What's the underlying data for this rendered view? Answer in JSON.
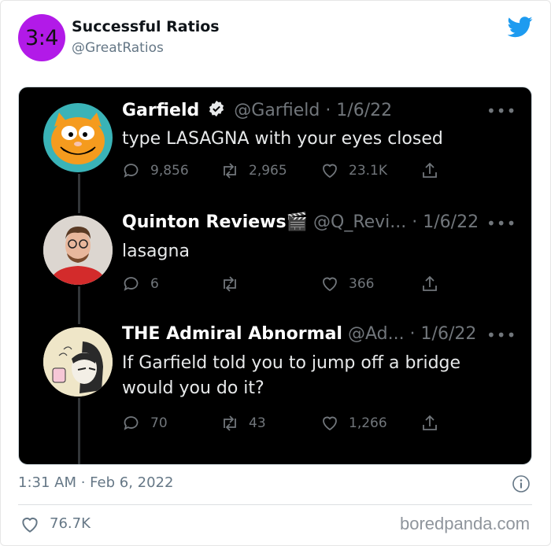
{
  "header": {
    "avatar_text": "3:4",
    "display_name": "Successful Ratios",
    "handle": "@GreatRatios",
    "icon": "twitter-bird-icon"
  },
  "tweets": [
    {
      "name": "Garfield",
      "badge": "verified",
      "meta": "@Garfield · 1/6/22",
      "text": "type LASAGNA with your eyes closed",
      "replies": "9,856",
      "retweets": "2,965",
      "likes": "23.1K",
      "avatar": "garfield-avatar"
    },
    {
      "name": "Quinton Reviews",
      "name_emoji": "🎬",
      "meta": "@Q_Revi... · 1/6/22",
      "text": "lasagna",
      "replies": "6",
      "retweets": "",
      "likes": "366",
      "avatar": "quinton-avatar"
    },
    {
      "name": "THE Admiral Abnormal",
      "meta": "@Ad... · 1/6/22",
      "text_line1": "If Garfield told you to jump off a bridge",
      "text_line2": "would you do it?",
      "replies": "70",
      "retweets": "43",
      "likes": "1,266",
      "avatar": "admiral-avatar"
    }
  ],
  "footer": {
    "timestamp": "1:31 AM · Feb 6, 2022",
    "likes": "76.7K",
    "credit": "boredpanda.com"
  },
  "colors": {
    "accent_purple": "#b21ae8",
    "twitter_blue": "#1d9bf0",
    "dark_bg": "#000000",
    "muted_text": "#71767b"
  }
}
